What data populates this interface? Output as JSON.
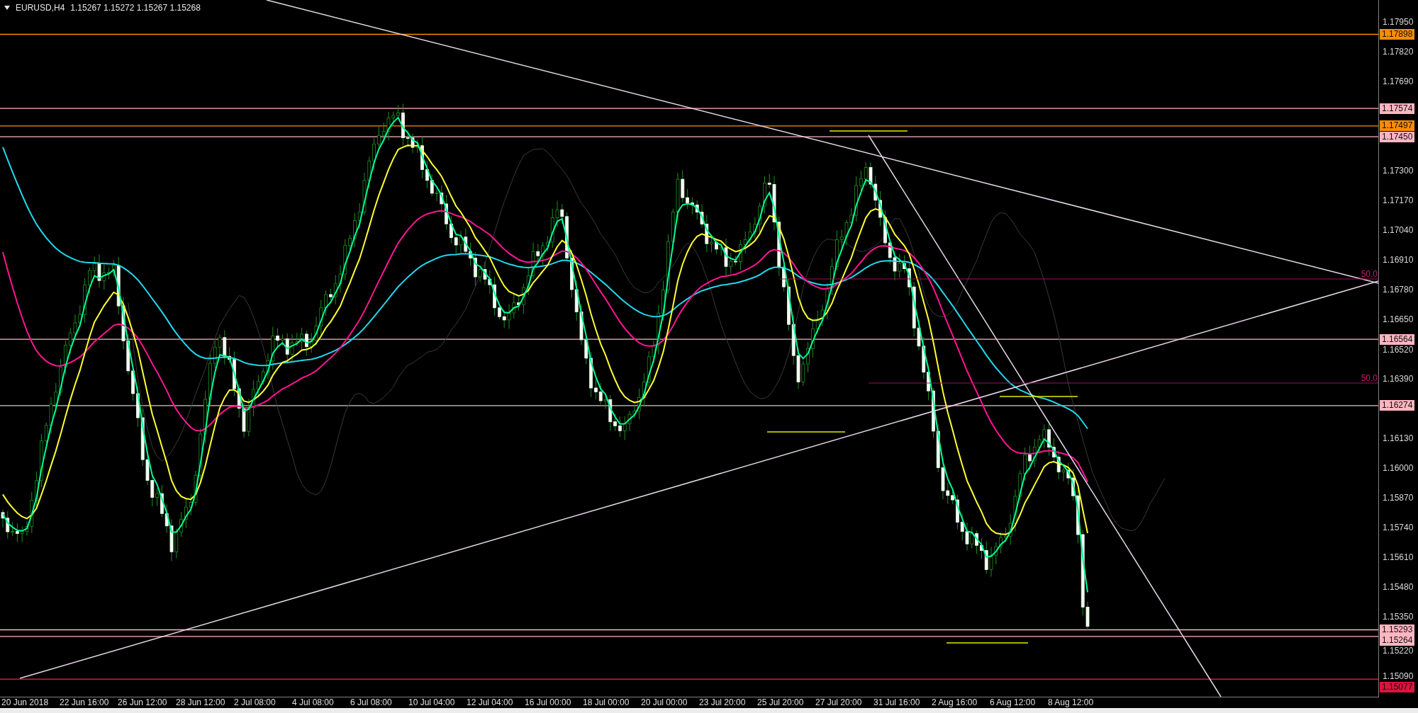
{
  "header": {
    "symbol": "EURUSD,H4",
    "ohlc": "1.15267 1.15272 1.15267 1.15268"
  },
  "price_axis": {
    "ticks": [
      "1.17950",
      "1.17820",
      "1.17690",
      "1.17300",
      "1.17170",
      "1.17040",
      "1.16910",
      "1.16780",
      "1.16650",
      "1.16520",
      "1.16390",
      "1.16130",
      "1.16000",
      "1.15870",
      "1.15740",
      "1.15610",
      "1.15480",
      "1.15350",
      "1.15220",
      "1.15090"
    ]
  },
  "price_levels": [
    {
      "price": "1.17898",
      "color": "#ff8c00"
    },
    {
      "price": "1.17574",
      "color": "#ffb6c1"
    },
    {
      "price": "1.17497",
      "color": "#ff8c00"
    },
    {
      "price": "1.17450",
      "color": "#ffb6c1"
    },
    {
      "price": "1.16564",
      "color": "#ffb6c1"
    },
    {
      "price": "1.16274",
      "color": "#ffb6c1"
    },
    {
      "price": "1.15293",
      "color": "#ffb6c1"
    },
    {
      "price": "1.15264",
      "color": "#ffb6c1"
    },
    {
      "price": "1.15077",
      "color": "#dc143c"
    }
  ],
  "fib_labels": [
    "50.0",
    "50.0"
  ],
  "time_axis": {
    "labels": [
      "20 Jun 2018",
      "22 Jun 16:00",
      "26 Jun 12:00",
      "28 Jun 12:00",
      "2 Jul 08:00",
      "4 Jul 08:00",
      "6 Jul 08:00",
      "10 Jul 04:00",
      "12 Jul 04:00",
      "16 Jul 00:00",
      "18 Jul 00:00",
      "20 Jul 00:00",
      "23 Jul 20:00",
      "25 Jul 20:00",
      "27 Jul 20:00",
      "31 Jul 16:00",
      "2 Aug 16:00",
      "6 Aug 12:00",
      "8 Aug 12:00"
    ]
  }
}
